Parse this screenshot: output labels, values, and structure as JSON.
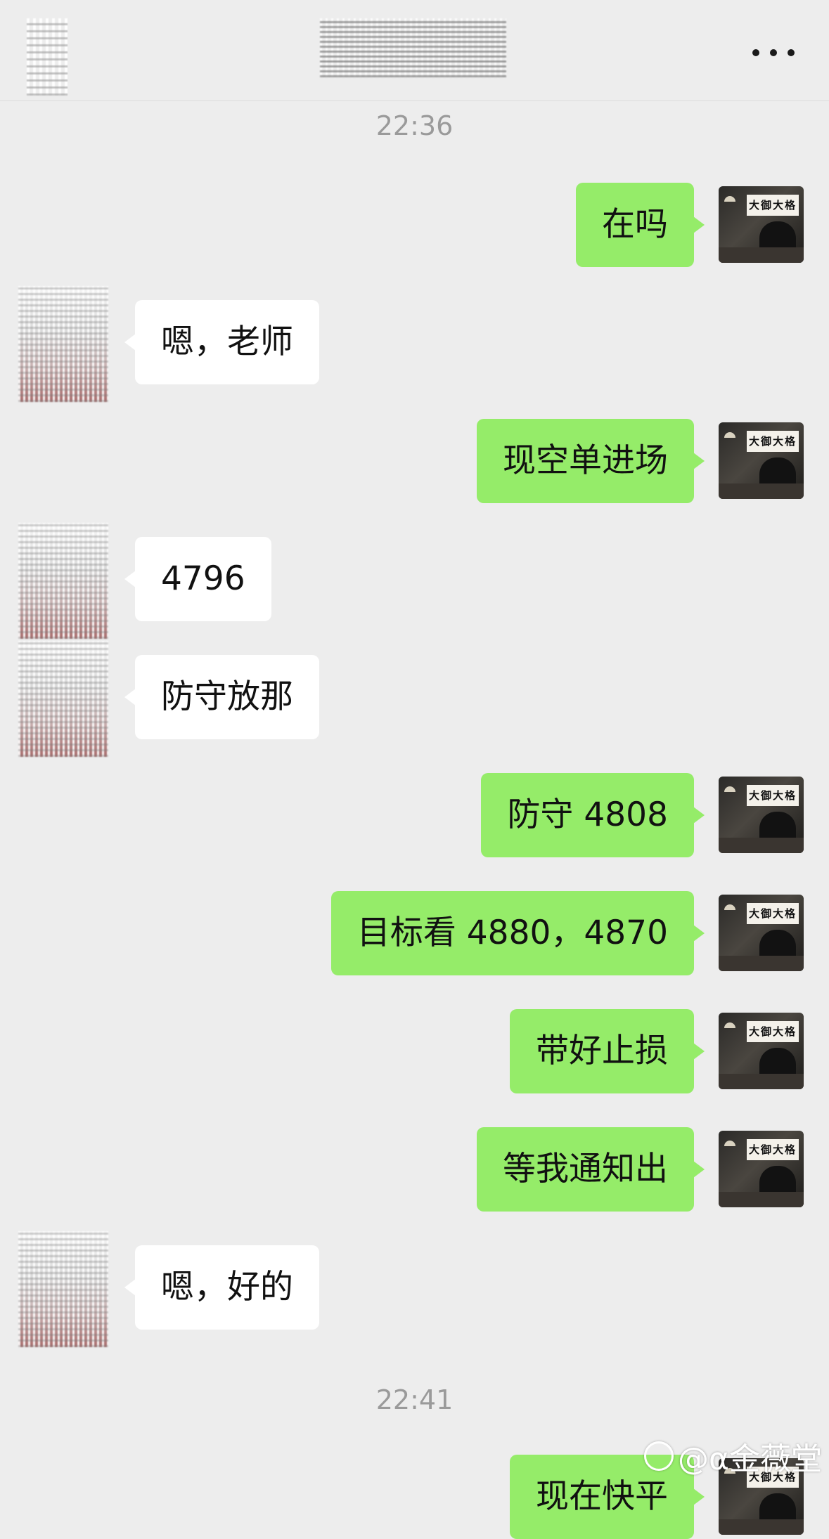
{
  "header": {
    "back_icon": "chevron-left-icon",
    "title": "",
    "more_icon": "more-dots-icon"
  },
  "timestamps": [
    "22:36",
    "22:41"
  ],
  "self_avatar": {
    "sign_text": "大御大格"
  },
  "messages": [
    {
      "direction": "out",
      "text": "在吗"
    },
    {
      "direction": "in",
      "text": "嗯，老师"
    },
    {
      "direction": "out",
      "text": "现空单进场"
    },
    {
      "direction": "in",
      "text": "4796"
    },
    {
      "direction": "in",
      "text": "防守放那"
    },
    {
      "direction": "out",
      "text": "防守 4808"
    },
    {
      "direction": "out",
      "text": "目标看 4880，4870"
    },
    {
      "direction": "out",
      "text": "带好止损"
    },
    {
      "direction": "out",
      "text": "等我通知出"
    },
    {
      "direction": "in",
      "text": "嗯，好的"
    },
    {
      "direction": "out",
      "text": "现在快平"
    }
  ],
  "watermark": "@α金薇堂",
  "colors": {
    "background": "#ededed",
    "outgoing_bubble": "#95ec69",
    "incoming_bubble": "#ffffff",
    "timestamp": "#9a9a9a"
  }
}
